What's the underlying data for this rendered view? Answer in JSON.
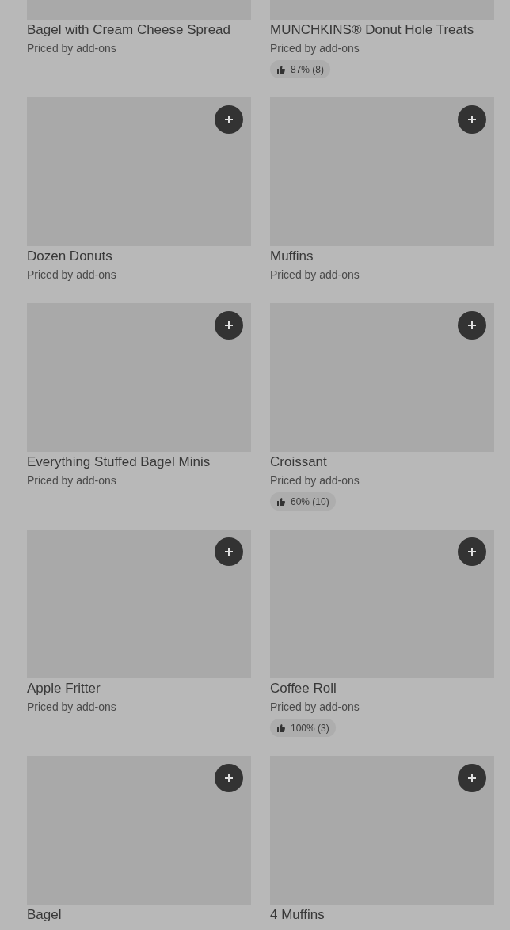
{
  "items": [
    {
      "name": "Bagel with Cream Cheese Spread",
      "price": "Priced by add-ons"
    },
    {
      "name": "MUNCHKINS® Donut Hole Treats",
      "price": "Priced by add-ons",
      "rating": "87% (8)"
    },
    {
      "name": "Dozen Donuts",
      "price": "Priced by add-ons"
    },
    {
      "name": "Muffins",
      "price": "Priced by add-ons"
    },
    {
      "name": "Everything Stuffed Bagel Minis",
      "price": "Priced by add-ons"
    },
    {
      "name": "Croissant",
      "price": "Priced by add-ons",
      "rating": "60% (10)"
    },
    {
      "name": "Apple Fritter",
      "price": "Priced by add-ons"
    },
    {
      "name": "Coffee Roll",
      "price": "Priced by add-ons",
      "rating": "100% (3)"
    },
    {
      "name": "Bagel"
    },
    {
      "name": "4 Muffins"
    }
  ]
}
